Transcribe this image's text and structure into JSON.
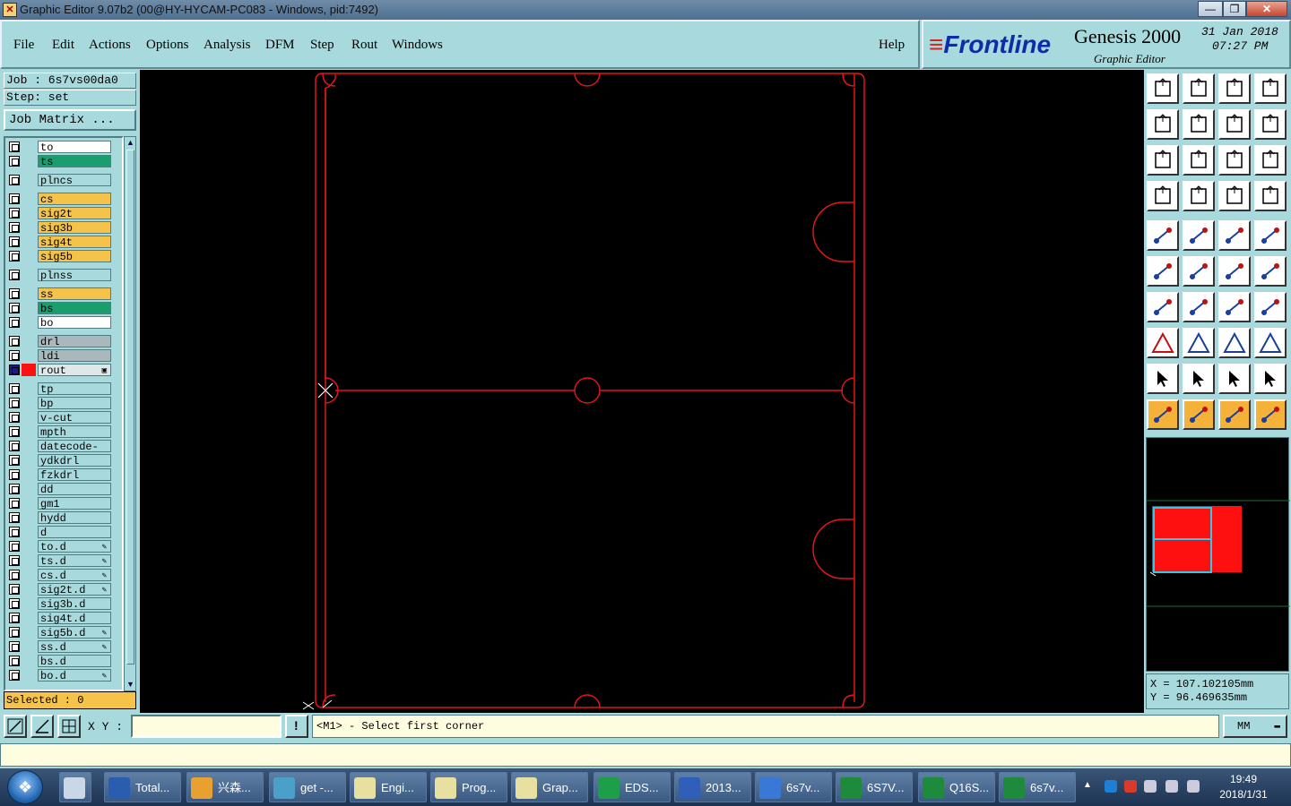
{
  "window": {
    "title": "Graphic Editor 9.07b2 (00@HY-HYCAM-PC083 - Windows, pid:7492)",
    "minimize": "—",
    "maximize": "❐",
    "close": "✕"
  },
  "menu": {
    "items": [
      "File",
      "Edit",
      "Actions",
      "Options",
      "Analysis",
      "DFM",
      "Step",
      "Rout",
      "Windows"
    ],
    "help": "Help"
  },
  "branding": {
    "logo": "Frontline",
    "product": "Genesis 2000",
    "subtitle": "Graphic Editor",
    "date": "31 Jan 2018",
    "time": "07:27 PM"
  },
  "job": {
    "job_label": "Job : 6s7vs00da0",
    "step_label": "Step: set",
    "matrix_button": "Job Matrix ..."
  },
  "layers": [
    {
      "name": "to",
      "color": "#ffffff",
      "group": 0
    },
    {
      "name": "ts",
      "color": "#1a9e6e",
      "group": 0
    },
    {
      "name": "plncs",
      "color": "#a8dadd",
      "group": 1
    },
    {
      "name": "cs",
      "color": "#f5c24a",
      "group": 2
    },
    {
      "name": "sig2t",
      "color": "#f5c24a",
      "group": 2
    },
    {
      "name": "sig3b",
      "color": "#f5c24a",
      "group": 2
    },
    {
      "name": "sig4t",
      "color": "#f5c24a",
      "group": 2
    },
    {
      "name": "sig5b",
      "color": "#f5c24a",
      "group": 2
    },
    {
      "name": "plnss",
      "color": "#a8dadd",
      "group": 3
    },
    {
      "name": "ss",
      "color": "#f5c24a",
      "group": 4
    },
    {
      "name": "bs",
      "color": "#1a9e6e",
      "group": 4
    },
    {
      "name": "bo",
      "color": "#ffffff",
      "group": 4
    },
    {
      "name": "drl",
      "color": "#a8b8bc",
      "group": 5
    },
    {
      "name": "ldi",
      "color": "#a8b8bc",
      "group": 5
    },
    {
      "name": "rout",
      "color": "#dfe8e8",
      "group": 5,
      "active": true
    },
    {
      "name": "tp",
      "color": "#a8dadd",
      "group": 6
    },
    {
      "name": "bp",
      "color": "#a8dadd",
      "group": 6
    },
    {
      "name": "v-cut",
      "color": "#a8dadd",
      "group": 6
    },
    {
      "name": "mpth",
      "color": "#a8dadd",
      "group": 6
    },
    {
      "name": "datecode-to",
      "color": "#a8dadd",
      "group": 6
    },
    {
      "name": "ydkdrl",
      "color": "#a8dadd",
      "group": 6
    },
    {
      "name": "fzkdrl",
      "color": "#a8dadd",
      "group": 6
    },
    {
      "name": "dd",
      "color": "#a8dadd",
      "group": 6
    },
    {
      "name": "gm1",
      "color": "#a8dadd",
      "group": 6
    },
    {
      "name": "hydd",
      "color": "#a8dadd",
      "group": 6
    },
    {
      "name": "d",
      "color": "#a8dadd",
      "group": 6
    },
    {
      "name": "to.d",
      "color": "#a8dadd",
      "group": 6,
      "mark": true
    },
    {
      "name": "ts.d",
      "color": "#a8dadd",
      "group": 6,
      "mark": true
    },
    {
      "name": "cs.d",
      "color": "#a8dadd",
      "group": 6,
      "mark": true
    },
    {
      "name": "sig2t.d",
      "color": "#a8dadd",
      "group": 6,
      "mark": true
    },
    {
      "name": "sig3b.d",
      "color": "#a8dadd",
      "group": 6
    },
    {
      "name": "sig4t.d",
      "color": "#a8dadd",
      "group": 6
    },
    {
      "name": "sig5b.d",
      "color": "#a8dadd",
      "group": 6,
      "mark": true
    },
    {
      "name": "ss.d",
      "color": "#a8dadd",
      "group": 6,
      "mark": true
    },
    {
      "name": "bs.d",
      "color": "#a8dadd",
      "group": 6
    },
    {
      "name": "bo.d",
      "color": "#a8dadd",
      "group": 6,
      "mark": true
    }
  ],
  "selection": {
    "label": "Selected : 0"
  },
  "coordinates": {
    "x": "X  = 107.102105mm",
    "y": "Y  = 96.469635mm"
  },
  "command": {
    "xy_label": "X Y :",
    "xy_value": "",
    "message_icon": "!",
    "message": "<M1> - Select first corner",
    "units": "MM"
  },
  "taskbar": {
    "items": [
      {
        "label": "Total...",
        "color": "#2a5db0"
      },
      {
        "label": "兴森...",
        "color": "#e8a030"
      },
      {
        "label": "get -...",
        "color": "#4aa0c8"
      },
      {
        "label": "Engi...",
        "color": "#e8e0a0"
      },
      {
        "label": "Prog...",
        "color": "#e8e0a0"
      },
      {
        "label": "Grap...",
        "color": "#e8e0a0"
      },
      {
        "label": "EDS...",
        "color": "#1f9e4a"
      },
      {
        "label": "2013...",
        "color": "#2f5fb8"
      },
      {
        "label": "6s7v...",
        "color": "#3a78d8"
      },
      {
        "label": "6S7V...",
        "color": "#1d8a3c"
      },
      {
        "label": "Q16S...",
        "color": "#1d8a3c"
      },
      {
        "label": "6s7v...",
        "color": "#1d8a3c"
      }
    ],
    "clock_time": "19:49",
    "clock_date": "2018/1/31"
  }
}
